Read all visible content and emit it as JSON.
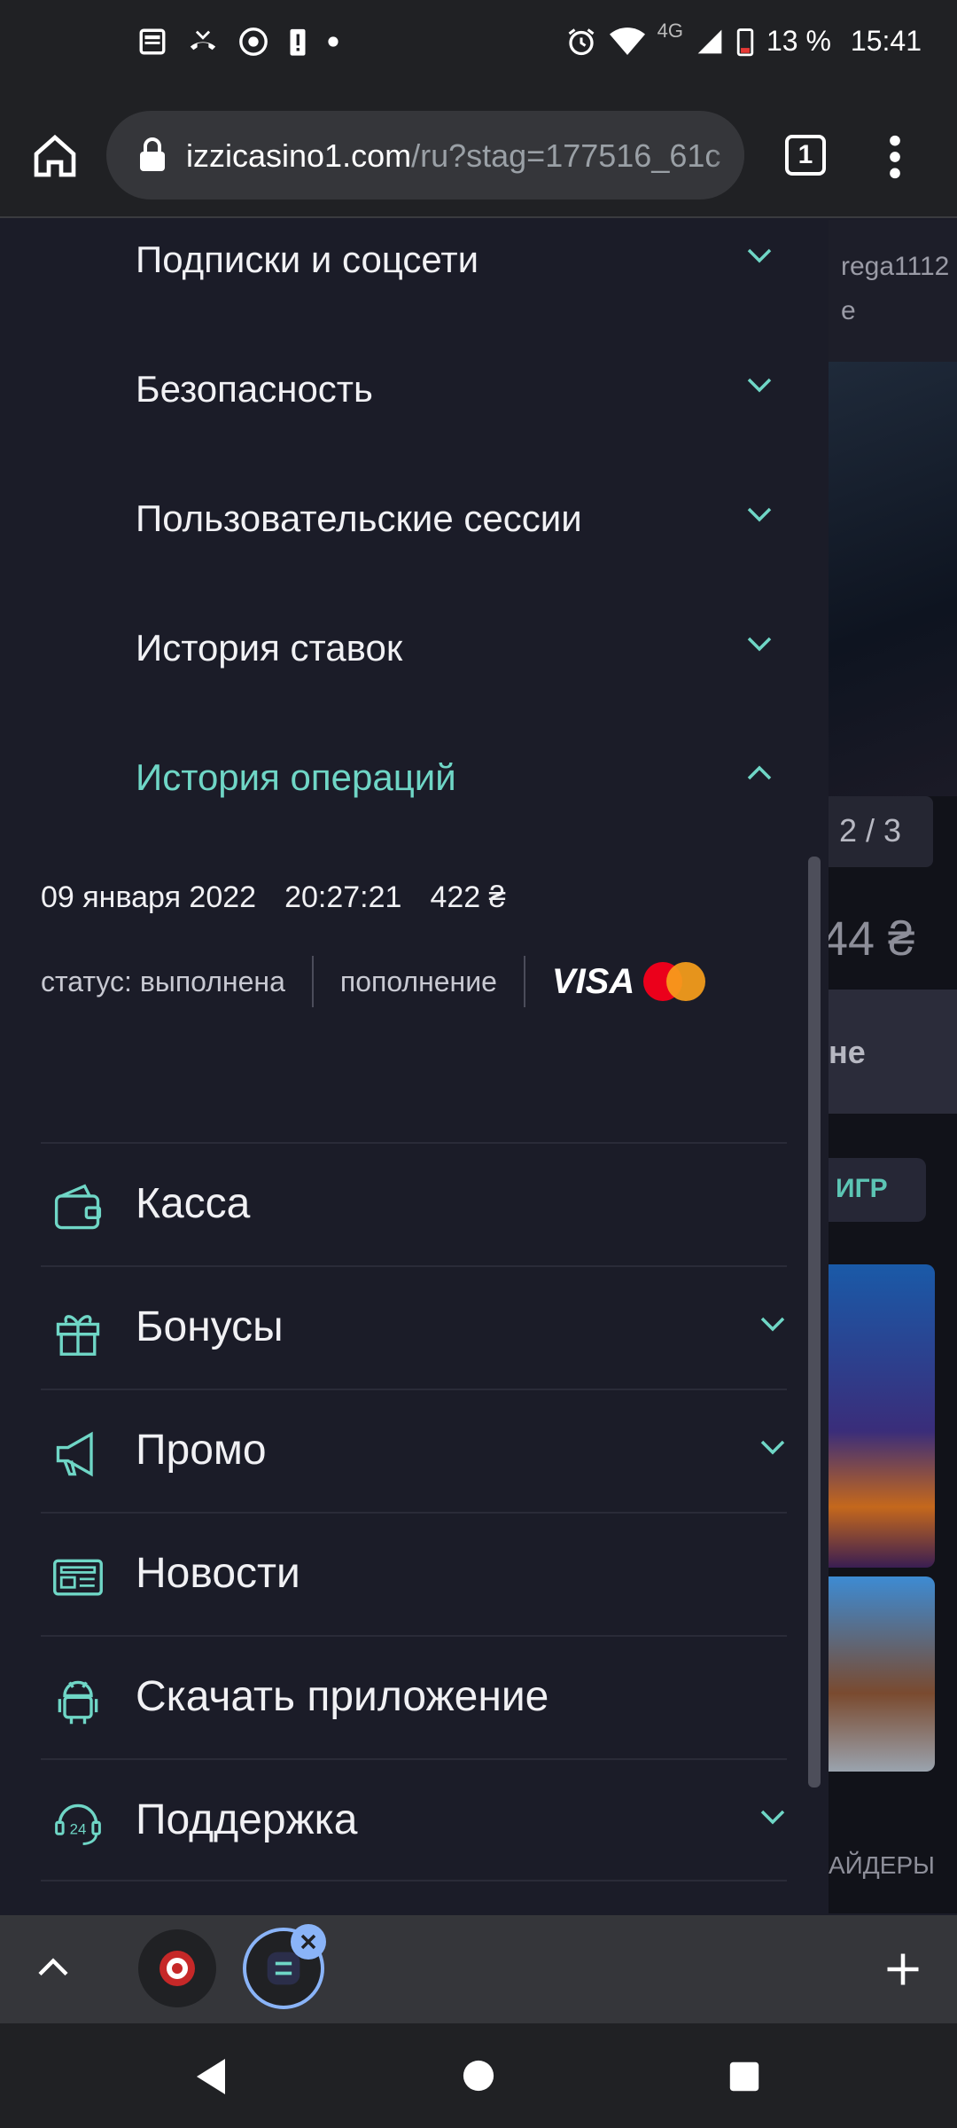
{
  "status_bar": {
    "network": "4G",
    "battery": "13 %",
    "time": "15:41"
  },
  "browser": {
    "url_host": "izzicasino1.com",
    "url_rest": "/ru?stag=177516_61c",
    "tab_count": "1"
  },
  "background_site": {
    "username": "rega1112",
    "small_text": "е",
    "pager": "2 / 3",
    "amount": "44 ₴",
    "button_text": "не",
    "games_button": "ИГР",
    "providers": "АЙДЕРЫ"
  },
  "drawer": {
    "accordion": [
      {
        "label": "Подписки и соцсети"
      },
      {
        "label": "Безопасность"
      },
      {
        "label": "Пользовательские сессии"
      },
      {
        "label": "История ставок"
      },
      {
        "label": "История операций"
      }
    ],
    "operation": {
      "date": "09 января 2022",
      "time": "20:27:21",
      "amount": "422 ₴",
      "status": "статус: выполнена",
      "type": "пополнение",
      "payment_brand": "VISA"
    },
    "menu": [
      {
        "label": "Касса",
        "icon": "wallet-icon"
      },
      {
        "label": "Бонусы",
        "icon": "gift-icon"
      },
      {
        "label": "Промо",
        "icon": "megaphone-icon"
      },
      {
        "label": "Новости",
        "icon": "news-icon"
      },
      {
        "label": "Скачать приложение",
        "icon": "android-icon"
      },
      {
        "label": "Поддержка",
        "icon": "support-24-icon"
      }
    ]
  },
  "colors": {
    "accent": "#6fd6c6",
    "drawer_bg": "#1b1c28",
    "browser_bg": "#202124"
  }
}
